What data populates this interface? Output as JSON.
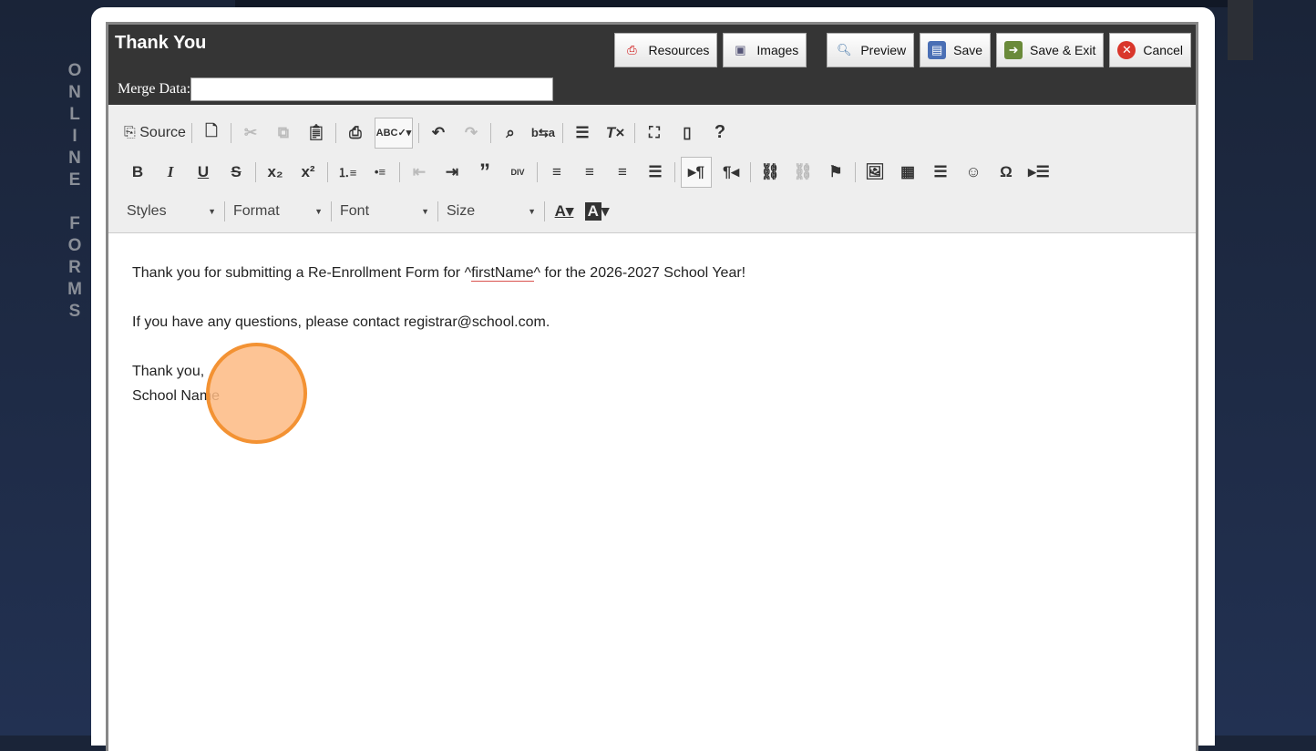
{
  "side_brand": [
    "O",
    "N",
    "L",
    "I",
    "N",
    "E",
    " ",
    "F",
    "O",
    "R",
    "M",
    "S"
  ],
  "header": {
    "title": "Thank You",
    "merge_label": "Merge Data:",
    "merge_value": "",
    "buttons": [
      {
        "label": "Resources",
        "icon": "pdf-icon"
      },
      {
        "label": "Images",
        "icon": "images-icon"
      },
      {
        "label": "Preview",
        "icon": "magnifier-icon"
      },
      {
        "label": "Save",
        "icon": "floppy-icon"
      },
      {
        "label": "Save & Exit",
        "icon": "save-exit-icon"
      },
      {
        "label": "Cancel",
        "icon": "cancel-icon"
      }
    ]
  },
  "toolbar": {
    "source_label": "Source",
    "styles": "Styles",
    "format": "Format",
    "font": "Font",
    "size": "Size"
  },
  "content": {
    "line1_pre": "Thank you for submitting a Re-Enrollment Form for ^",
    "line1_field": "firstName",
    "line1_post": "^ for the 2026-2027 School Year!",
    "line2": "If you have any questions, please contact registrar@school.com.",
    "line3": "Thank you,",
    "line4": "School Name"
  }
}
